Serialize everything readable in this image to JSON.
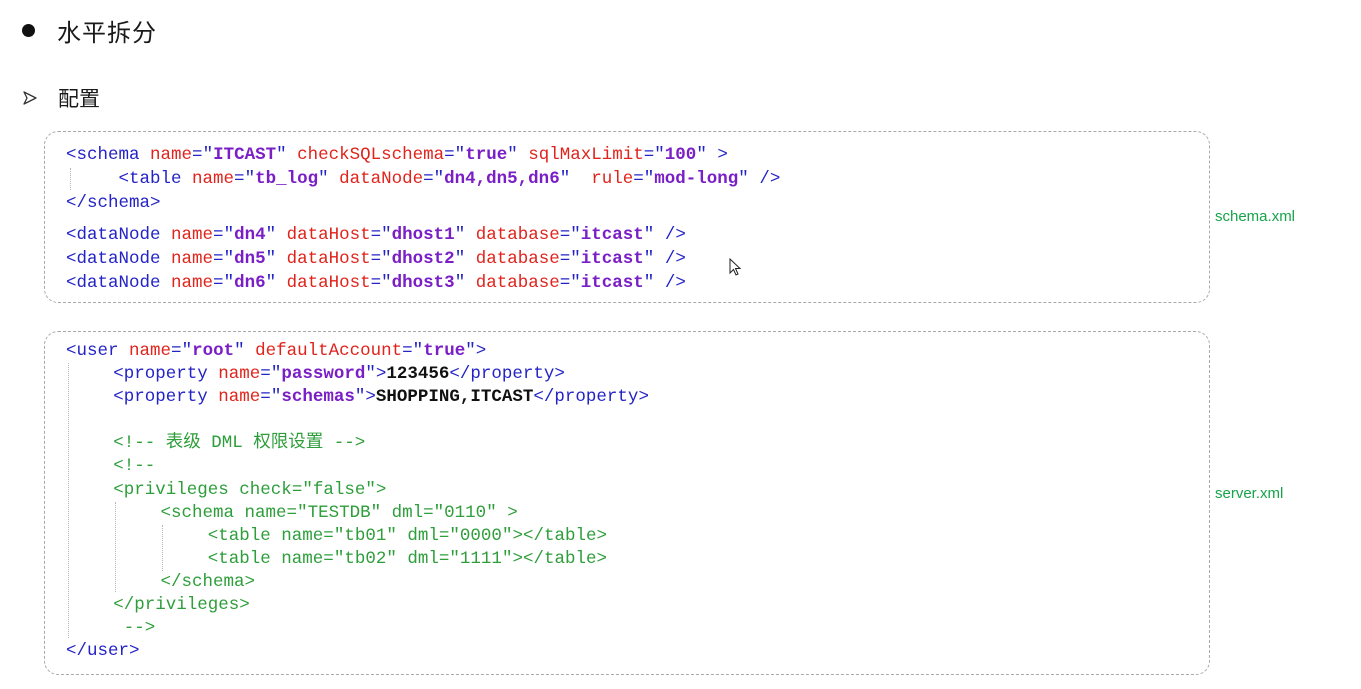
{
  "heading": "水平拆分",
  "subheading": "配置",
  "schema_file_label": "schema.xml",
  "server_file_label": "server.xml",
  "icons": {
    "bullet": "bullet-dot-icon",
    "arrow": "arrow-right-icon",
    "cursor": "mouse-cursor-icon"
  },
  "colors": {
    "tag": "#2323c6",
    "attribute": "#e0241c",
    "value": "#7a1ec6",
    "comment": "#2e9e3b",
    "label": "#16a34a"
  },
  "schema_xml": [
    "<schema name=\"ITCAST\" checkSQLschema=\"true\" sqlMaxLimit=\"100\" >",
    "<table name=\"tb_log\" dataNode=\"dn4,dn5,dn6\"  rule=\"mod-long\" />",
    "</schema>",
    "<dataNode name=\"dn4\" dataHost=\"dhost1\" database=\"itcast\" />",
    "<dataNode name=\"dn5\" dataHost=\"dhost2\" database=\"itcast\" />",
    "<dataNode name=\"dn6\" dataHost=\"dhost3\" database=\"itcast\" />"
  ],
  "server_xml": [
    "<user name=\"root\" defaultAccount=\"true\">",
    "<property name=\"password\">123456</property>",
    "<property name=\"schemas\">SHOPPING,ITCAST</property>",
    "<!-- 表级 DML 权限设置 -->",
    "<!--",
    "<privileges check=\"false\">",
    "<schema name=\"TESTDB\" dml=\"0110\" >",
    "<table name=\"tb01\" dml=\"0000\"></table>",
    "<table name=\"tb02\" dml=\"1111\"></table>",
    "</schema>",
    "</privileges>",
    "-->",
    "</user>"
  ]
}
